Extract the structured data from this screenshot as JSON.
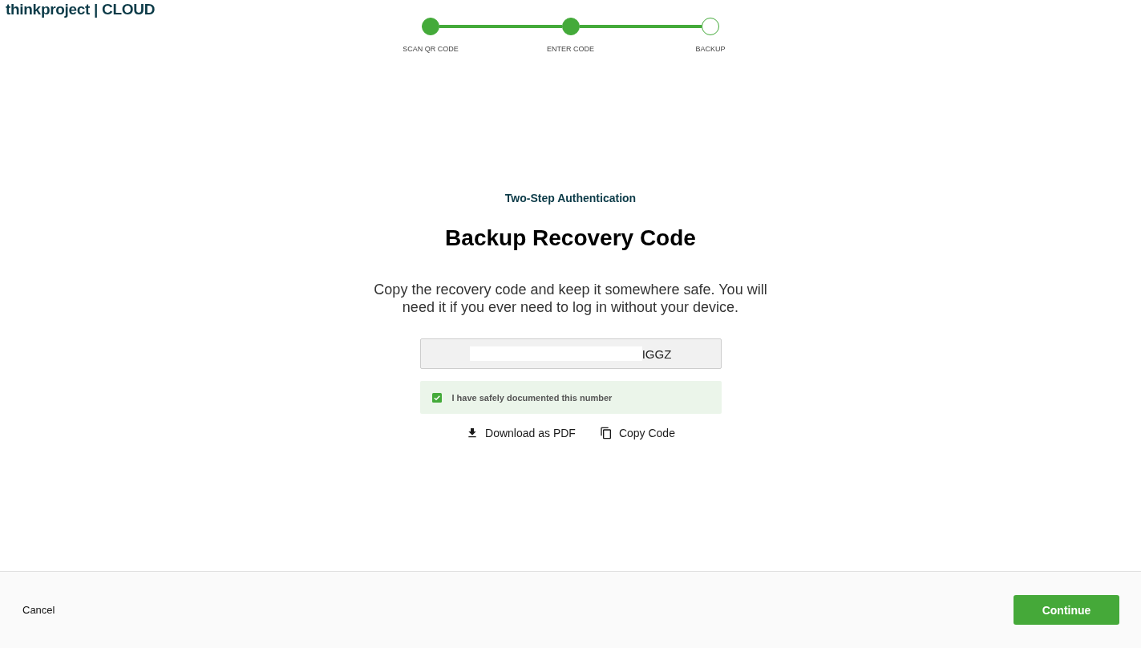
{
  "logo": {
    "text": "thinkproject | CLOUD"
  },
  "stepper": {
    "steps": [
      {
        "label": "SCAN QR CODE",
        "done": true
      },
      {
        "label": "ENTER CODE",
        "done": true
      },
      {
        "label": "BACKUP",
        "done": false
      }
    ]
  },
  "content": {
    "eyebrow": "Two-Step Authentication",
    "title": "Backup Recovery Code",
    "description": "Copy the recovery code and keep it somewhere safe. You will need it if you ever need to log in without your device.",
    "code_field": {
      "value": "IGGZ",
      "redacted": true
    },
    "confirmation": {
      "label": "I have safely documented this number",
      "checked": true
    },
    "actions": [
      {
        "kind": "download",
        "label": "Download as PDF"
      },
      {
        "kind": "copy",
        "label": "Copy Code"
      }
    ]
  },
  "footer": {
    "cancel": "Cancel",
    "continue": "Continue"
  }
}
